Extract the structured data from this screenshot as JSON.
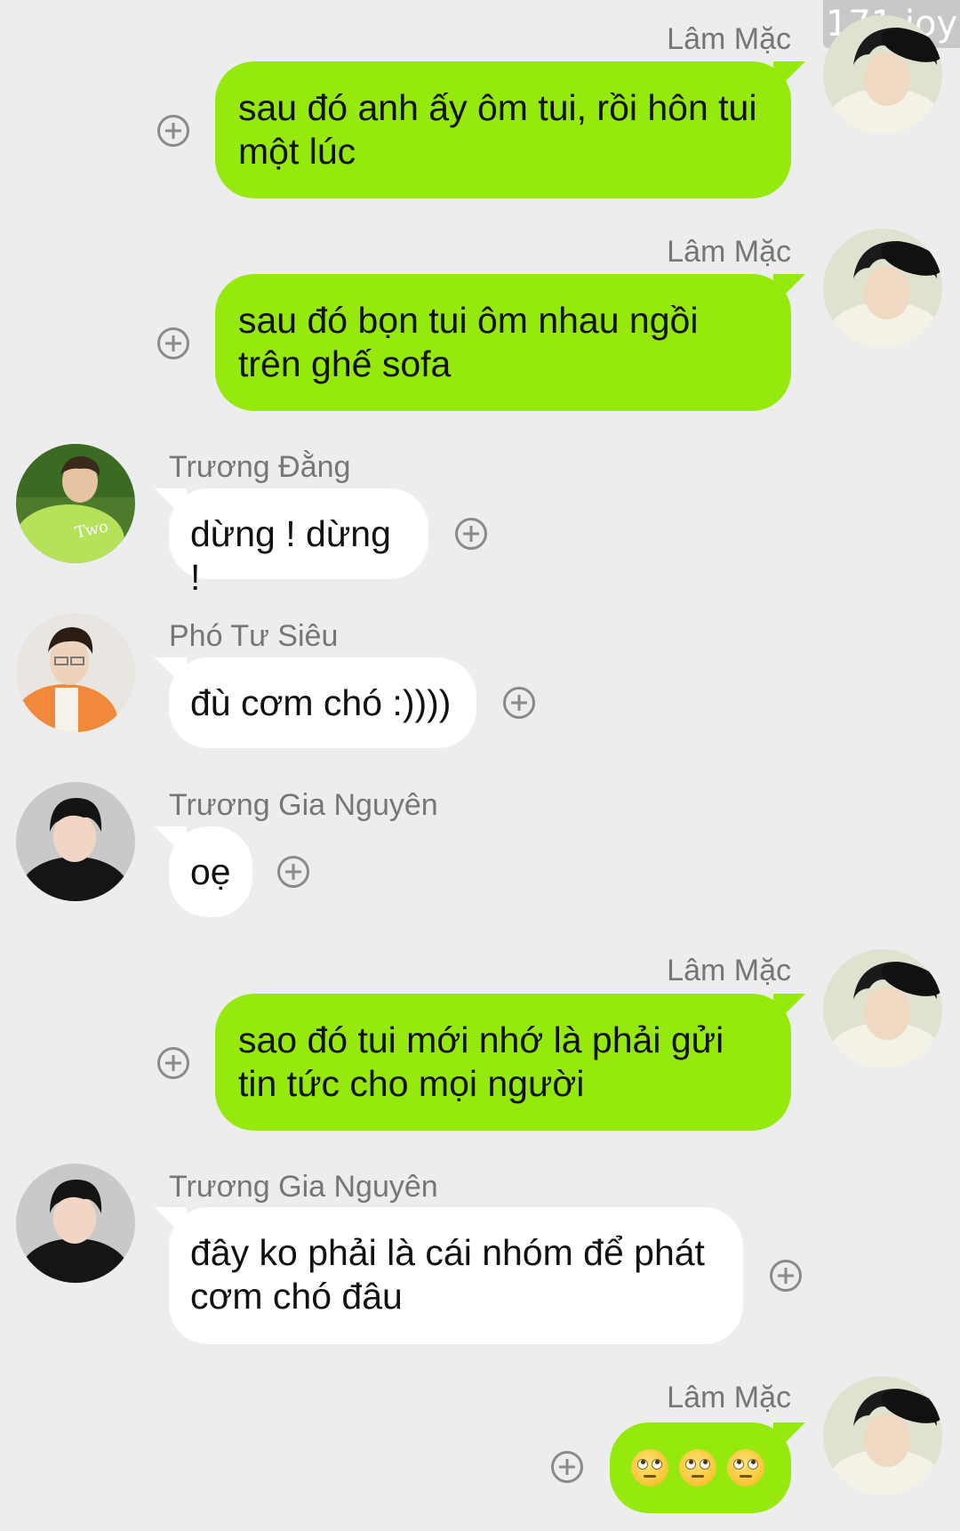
{
  "watermark": "171 joy",
  "messages": [
    {
      "sender": "Lâm Mặc",
      "text": "sau đó anh ấy ôm tui, rồi hôn tui một lúc"
    },
    {
      "sender": "Lâm Mặc",
      "text": "sau đó bọn tui ôm nhau ngồi trên ghế sofa"
    },
    {
      "sender": "Trương Đằng",
      "text": "dừng ! dừng !"
    },
    {
      "sender": "Phó Tư Siêu",
      "text": "đù cơm chó :))))"
    },
    {
      "sender": "Trương Gia Nguyên",
      "text": "oẹ"
    },
    {
      "sender": "Lâm Mặc",
      "text": "sao đó tui mới nhớ là phải gửi tin tức cho mọi người"
    },
    {
      "sender": "Trương Gia Nguyên",
      "text": "đây ko phải là cái nhóm để phát cơm chó đâu"
    },
    {
      "sender": "Lâm Mặc",
      "emoji": [
        "face-with-rolling-eyes",
        "face-with-rolling-eyes",
        "face-with-rolling-eyes"
      ]
    }
  ],
  "colors": {
    "background": "#ededed",
    "outgoing_bubble": "#95e90d",
    "incoming_bubble": "#ffffff",
    "sender_name": "#767676",
    "add_icon": "#8a8a8a"
  },
  "icons": {
    "add": "plus-circle-icon",
    "emoji": "face-with-rolling-eyes"
  }
}
